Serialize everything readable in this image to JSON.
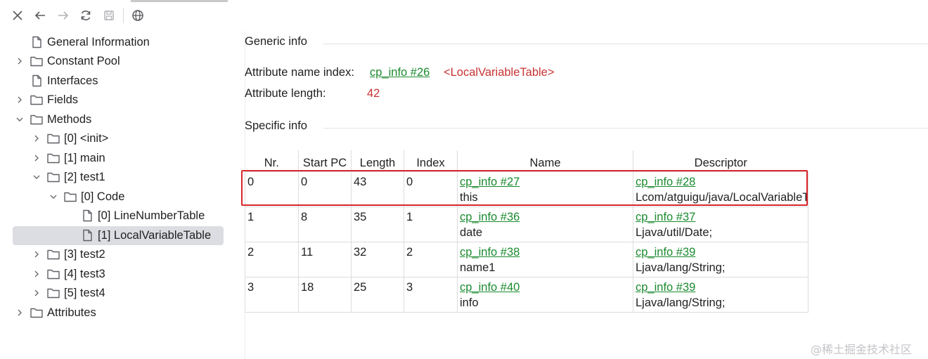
{
  "toolbar": {
    "icons": [
      "close-icon",
      "back-arrow-icon",
      "forward-arrow-icon",
      "refresh-icon",
      "save-icon",
      "globe-icon"
    ]
  },
  "tree": {
    "items": [
      {
        "label": "General Information",
        "icon": "file-icon",
        "has_chevron": false,
        "expanded": false
      },
      {
        "label": "Constant Pool",
        "icon": "folder-icon",
        "has_chevron": true,
        "expanded": false
      },
      {
        "label": "Interfaces",
        "icon": "file-icon",
        "has_chevron": false,
        "expanded": false
      },
      {
        "label": "Fields",
        "icon": "folder-icon",
        "has_chevron": true,
        "expanded": false
      },
      {
        "label": "Methods",
        "icon": "folder-icon",
        "has_chevron": true,
        "expanded": true
      },
      {
        "label": "[0] <init>",
        "icon": "folder-icon",
        "has_chevron": true,
        "expanded": false
      },
      {
        "label": "[1] main",
        "icon": "folder-icon",
        "has_chevron": true,
        "expanded": false
      },
      {
        "label": "[2] test1",
        "icon": "folder-icon",
        "has_chevron": true,
        "expanded": true
      },
      {
        "label": "[0] Code",
        "icon": "folder-icon",
        "has_chevron": true,
        "expanded": true
      },
      {
        "label": "[0] LineNumberTable",
        "icon": "file-icon",
        "has_chevron": false,
        "expanded": false
      },
      {
        "label": "[1] LocalVariableTable",
        "icon": "file-icon",
        "has_chevron": false,
        "expanded": false,
        "selected": true
      },
      {
        "label": "[3] test2",
        "icon": "folder-icon",
        "has_chevron": true,
        "expanded": false
      },
      {
        "label": "[4] test3",
        "icon": "folder-icon",
        "has_chevron": true,
        "expanded": false
      },
      {
        "label": "[5] test4",
        "icon": "folder-icon",
        "has_chevron": true,
        "expanded": false
      },
      {
        "label": "Attributes",
        "icon": "folder-icon",
        "has_chevron": true,
        "expanded": false
      }
    ]
  },
  "generic": {
    "title": "Generic info",
    "name_index_label": "Attribute name index:",
    "name_index_link": "cp_info #26",
    "name_index_value": "<LocalVariableTable>",
    "length_label": "Attribute length:",
    "length_value": "42"
  },
  "specific": {
    "title": "Specific info",
    "columns": [
      "Nr.",
      "Start PC",
      "Length",
      "Index",
      "Name",
      "Descriptor"
    ],
    "rows": [
      {
        "nr": "0",
        "start_pc": "0",
        "length": "43",
        "index": "0",
        "name_link": "cp_info #27",
        "name": "this",
        "desc_link": "cp_info #28",
        "desc": "Lcom/atguigu/java/LocalVariableTest;"
      },
      {
        "nr": "1",
        "start_pc": "8",
        "length": "35",
        "index": "1",
        "name_link": "cp_info #36",
        "name": "date",
        "desc_link": "cp_info #37",
        "desc": "Ljava/util/Date;"
      },
      {
        "nr": "2",
        "start_pc": "11",
        "length": "32",
        "index": "2",
        "name_link": "cp_info #38",
        "name": "name1",
        "desc_link": "cp_info #39",
        "desc": "Ljava/lang/String;"
      },
      {
        "nr": "3",
        "start_pc": "18",
        "length": "25",
        "index": "3",
        "name_link": "cp_info #40",
        "name": "info",
        "desc_link": "cp_info #39",
        "desc": "Ljava/lang/String;"
      }
    ]
  },
  "watermark": "@稀土掘金技术社区",
  "colors": {
    "link": "#1a8a2e",
    "value_red": "#c83232",
    "highlight_box": "#d9262b",
    "selected_row": "#dcdde2"
  }
}
